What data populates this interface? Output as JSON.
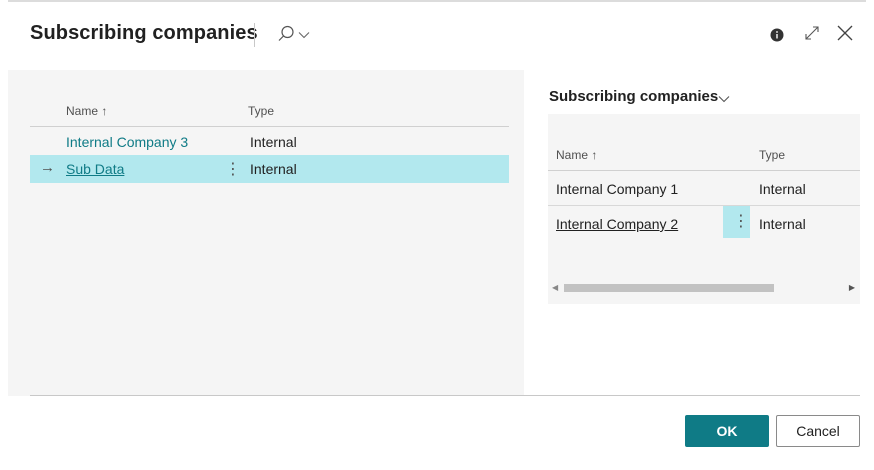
{
  "dialog": {
    "title": "Subscribing companies"
  },
  "left_list": {
    "columns": {
      "name": "Name ↑",
      "type": "Type"
    },
    "rows": [
      {
        "name": "Internal Company 3",
        "type": "Internal"
      },
      {
        "name": "Sub Data",
        "type": "Internal"
      }
    ],
    "row_actions": "⋮",
    "selected_marker": "→"
  },
  "right_panel": {
    "title": "Subscribing companies",
    "columns": {
      "name": "Name ↑",
      "type": "Type"
    },
    "rows": [
      {
        "name": "Internal Company 1",
        "type": "Internal"
      },
      {
        "name": "Internal Company 2",
        "type": "Internal"
      }
    ],
    "row_actions": "⋮"
  },
  "footer": {
    "ok_label": "OK",
    "cancel_label": "Cancel"
  },
  "colors": {
    "accent": "#0f7b86",
    "selected_row": "#b2e8ee",
    "panel_bg": "#f5f5f5"
  }
}
